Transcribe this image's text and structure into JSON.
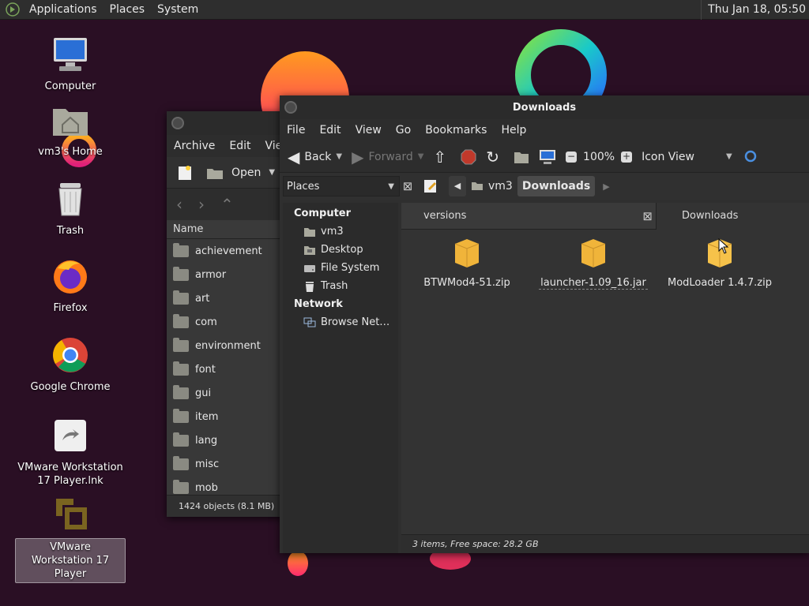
{
  "panel": {
    "menus": [
      "Applications",
      "Places",
      "System"
    ],
    "clock": "Thu Jan 18, 05:50"
  },
  "desktop_icons": [
    {
      "label": "Computer",
      "icon": "computer-icon"
    },
    {
      "label": "vm3's Home",
      "icon": "home-folder-icon"
    },
    {
      "label": "Trash",
      "icon": "trash-icon"
    },
    {
      "label": "Firefox",
      "icon": "firefox-icon"
    },
    {
      "label": "Google Chrome",
      "icon": "chrome-icon"
    },
    {
      "label": "VMware Workstation 17 Player.lnk",
      "icon": "shortcut-icon"
    },
    {
      "label": "VMware Workstation 17 Player",
      "icon": "vmware-icon",
      "selected": true
    }
  ],
  "archive_window": {
    "menu": [
      "Archive",
      "Edit",
      "View"
    ],
    "open_label": "Open",
    "column_header": "Name",
    "folders": [
      "achievement",
      "armor",
      "art",
      "com",
      "environment",
      "font",
      "gui",
      "item",
      "lang",
      "misc",
      "mob"
    ],
    "status": "1424 objects (8.1 MB)"
  },
  "downloads_window": {
    "title": "Downloads",
    "menu": [
      "File",
      "Edit",
      "View",
      "Go",
      "Bookmarks",
      "Help"
    ],
    "toolbar": {
      "back": "Back",
      "forward": "Forward",
      "zoom": "100%",
      "view_mode": "Icon View"
    },
    "side_pane_title": "Places",
    "breadcrumbs": [
      "vm3",
      "Downloads"
    ],
    "sidebar": {
      "computer_heading": "Computer",
      "computer_items": [
        "vm3",
        "Desktop",
        "File System",
        "Trash"
      ],
      "network_heading": "Network",
      "network_items": [
        "Browse Net…"
      ]
    },
    "tabs": [
      "versions",
      "Downloads"
    ],
    "files": [
      "BTWMod4-51.zip",
      "launcher-1.09_16.jar",
      "ModLoader 1.4.7.zip"
    ],
    "status": "3 items, Free space: 28.2 GB"
  },
  "colors": {
    "wallpaper": "#2a0f24",
    "panel": "#2e2e2e",
    "window": "#353535"
  }
}
